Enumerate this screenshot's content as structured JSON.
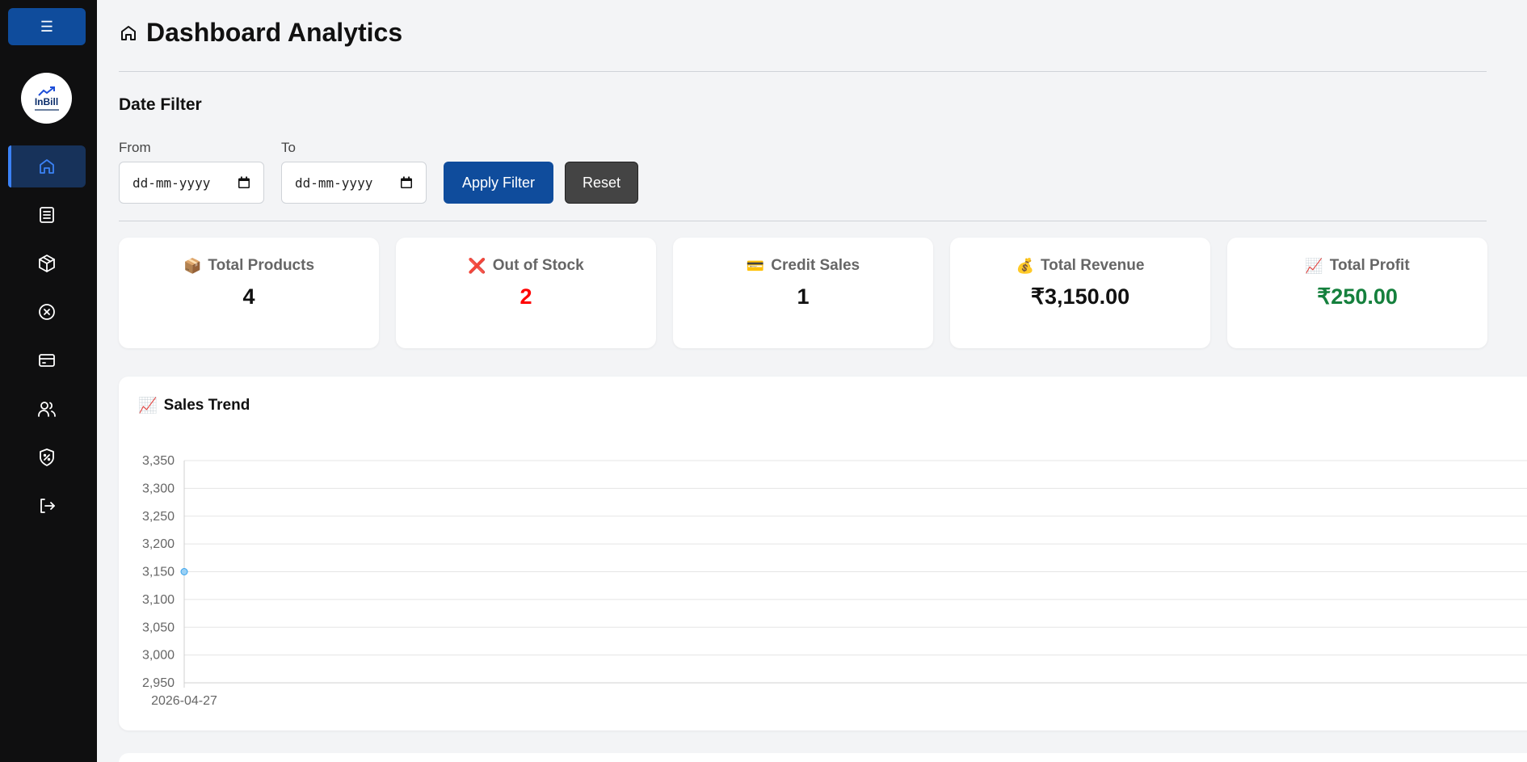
{
  "sidebar": {
    "menu_label": "☰",
    "logo_text": "InBill",
    "items": [
      {
        "icon": "home-icon",
        "active": true
      },
      {
        "icon": "document-list-icon",
        "active": false
      },
      {
        "icon": "box-icon",
        "active": false
      },
      {
        "icon": "circle-x-icon",
        "active": false
      },
      {
        "icon": "credit-card-icon",
        "active": false
      },
      {
        "icon": "users-icon",
        "active": false
      },
      {
        "icon": "shield-percent-icon",
        "active": false
      },
      {
        "icon": "logout-icon",
        "active": false
      }
    ]
  },
  "header": {
    "title": "Dashboard Analytics",
    "icon": "home-icon"
  },
  "filter": {
    "section_title": "Date Filter",
    "from_label": "From",
    "from_value": "dd-mm-yyyy",
    "to_label": "To",
    "to_value": "dd-mm-yyyy",
    "apply_label": "Apply Filter",
    "reset_label": "Reset"
  },
  "cards": [
    {
      "emoji": "📦",
      "label": "Total Products",
      "value": "4",
      "color": "#111111"
    },
    {
      "emoji": "❌",
      "label": "Out of Stock",
      "value": "2",
      "color": "#ff0000"
    },
    {
      "emoji": "💳",
      "label": "Credit Sales",
      "value": "1",
      "color": "#111111"
    },
    {
      "emoji": "💰",
      "label": "Total Revenue",
      "value": "₹3,150.00",
      "color": "#111111"
    },
    {
      "emoji": "📈",
      "label": "Total Profit",
      "value": "₹250.00",
      "color": "#15803d"
    }
  ],
  "chart": {
    "emoji": "📈",
    "title": "Sales Trend"
  },
  "chart_data": {
    "type": "line",
    "title": "Sales Trend",
    "x": [
      "2026-04-27"
    ],
    "series": [
      {
        "values": [
          3150
        ],
        "color": "#36a2eb"
      }
    ],
    "ylim": [
      2950,
      3350
    ],
    "yticks": [
      "3,350",
      "3,300",
      "3,250",
      "3,200",
      "3,150",
      "3,100",
      "3,050",
      "3,000",
      "2,950"
    ],
    "grid": true
  }
}
